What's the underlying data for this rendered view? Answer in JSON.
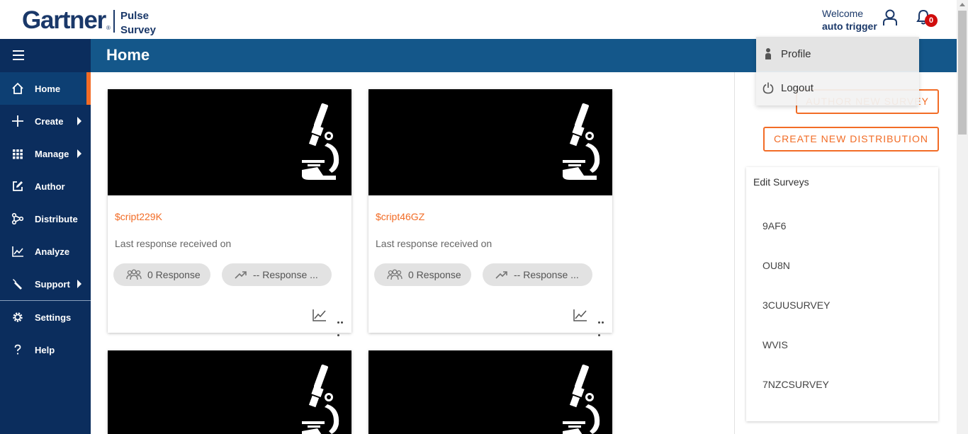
{
  "header": {
    "brand": "Gartner",
    "product_line1": "Pulse",
    "product_line2": "Survey",
    "welcome_label": "Welcome",
    "user_name": "auto trigger",
    "notification_count": "0",
    "user_icon": "user-icon",
    "bell_icon": "bell-icon"
  },
  "user_menu": {
    "items": [
      {
        "label": "Profile",
        "icon": "person-icon"
      },
      {
        "label": "Logout",
        "icon": "power-icon"
      }
    ]
  },
  "sidebar": {
    "items": [
      {
        "label": "Home",
        "icon": "home-icon",
        "active": true
      },
      {
        "label": "Create",
        "icon": "plus-icon",
        "has_submenu": true
      },
      {
        "label": "Manage",
        "icon": "grid-icon",
        "has_submenu": true
      },
      {
        "label": "Author",
        "icon": "edit-icon"
      },
      {
        "label": "Distribute",
        "icon": "share-icon"
      },
      {
        "label": "Analyze",
        "icon": "chart-icon"
      },
      {
        "label": "Support",
        "icon": "wrench-icon",
        "has_submenu": true
      },
      {
        "label": "Settings",
        "icon": "gear-icon"
      },
      {
        "label": "Help",
        "icon": "question-icon"
      }
    ]
  },
  "page": {
    "title": "Home"
  },
  "cards": [
    {
      "title": "$cript229K",
      "subtitle": "Last response received on",
      "responses": "0 Response",
      "trend": "-- Response ..."
    },
    {
      "title": "$cript46GZ",
      "subtitle": "Last response received on",
      "responses": "0 Response",
      "trend": "-- Response ..."
    }
  ],
  "right_panel": {
    "author_button": "AUTHOR NEW SURVEY",
    "distribution_button": "CREATE NEW DISTRIBUTION",
    "edit_surveys_title": "Edit Surveys",
    "surveys": [
      "9AF6",
      "OU8N",
      "3CUUSURVEY",
      "WVIS",
      "7NZCSURVEY"
    ]
  },
  "colors": {
    "brand_navy": "#0b2d5d",
    "titlebar_blue": "#14578a",
    "accent_orange": "#f26c26",
    "badge_red": "#d00d0d"
  }
}
